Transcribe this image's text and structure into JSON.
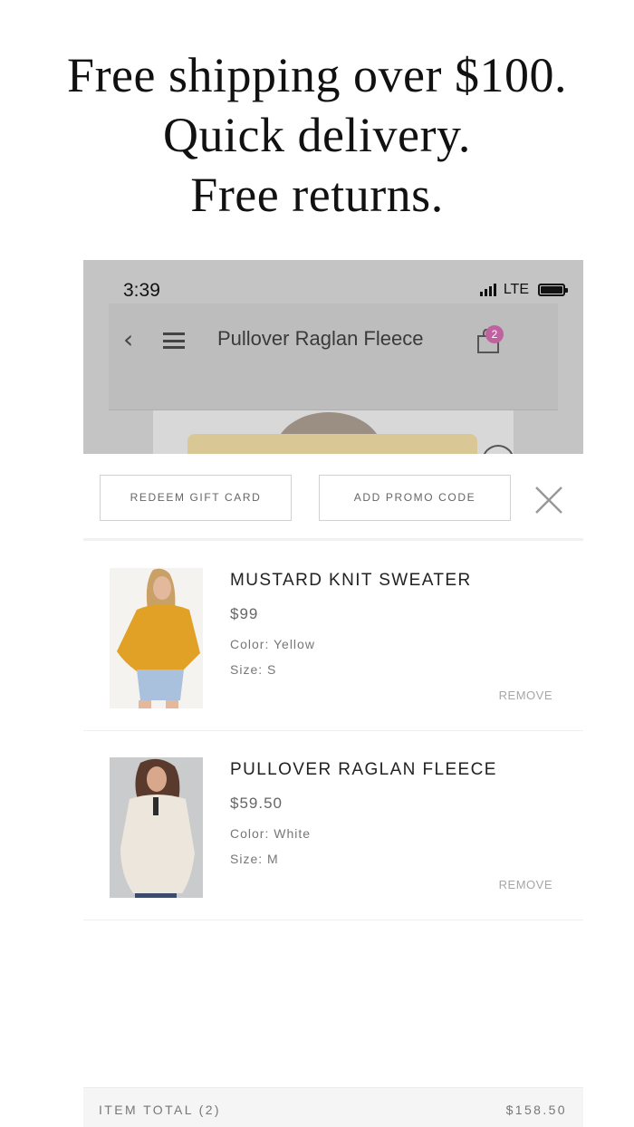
{
  "headline": {
    "line1": "Free shipping over $100.",
    "line2": "Quick delivery.",
    "line3": "Free returns."
  },
  "status_bar": {
    "time": "3:39",
    "network": "LTE"
  },
  "nav": {
    "back_icon": "chevron-left-icon",
    "menu_icon": "hamburger-menu-icon",
    "title": "Pullover Raglan Fleece",
    "cart_icon": "shopping-bag-icon",
    "cart_count": "2",
    "badge_color": "#c0629f"
  },
  "promo": {
    "gift_card_label": "REDEEM GIFT CARD",
    "promo_code_label": "ADD PROMO CODE",
    "close_icon": "close-icon"
  },
  "cart_items": [
    {
      "name": "MUSTARD KNIT SWEATER",
      "price": "$99",
      "color": "Color: Yellow",
      "size": "Size:  S",
      "remove_label": "REMOVE",
      "swatch": "#e0a126"
    },
    {
      "name": "PULLOVER RAGLAN FLEECE",
      "price": "$59.50",
      "color": "Color: White",
      "size": "Size:  M",
      "remove_label": "REMOVE",
      "swatch": "#ece6dc"
    }
  ],
  "total": {
    "label": "ITEM TOTAL (2)",
    "value": "$158.50"
  }
}
